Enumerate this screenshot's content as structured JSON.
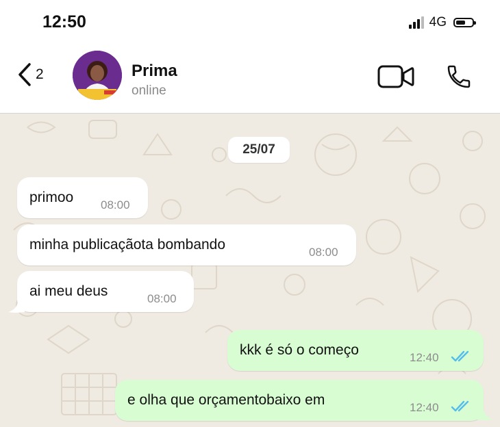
{
  "status_bar": {
    "time": "12:50",
    "network": "4G",
    "icons": [
      "signal-icon",
      "battery-icon"
    ]
  },
  "header": {
    "back_count": "2",
    "contact_name": "Prima",
    "contact_status": "online",
    "icons": [
      "chevron-left-icon",
      "video-call-icon",
      "phone-call-icon"
    ]
  },
  "chat": {
    "date": "25/07",
    "messages": [
      {
        "direction": "in",
        "text": "primoo",
        "time": "08:00"
      },
      {
        "direction": "in",
        "text": "minha publicaçãota bombando",
        "time": "08:00"
      },
      {
        "direction": "in",
        "text": "ai meu deus",
        "time": "08:00"
      },
      {
        "direction": "out",
        "text": "kkk é só o começo",
        "time": "12:40",
        "status": "read"
      },
      {
        "direction": "out",
        "text": "e olha que orçamentobaixo em",
        "time": "12:40",
        "status": "read"
      }
    ]
  },
  "colors": {
    "read_ticks": "#53bdeb",
    "outgoing_bubble": "#d9fdd3",
    "wallpaper": "#efeae2"
  }
}
